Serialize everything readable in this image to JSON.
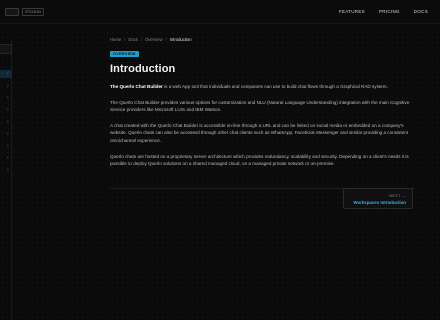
{
  "header": {
    "badge": "STUDIO",
    "nav": [
      "FEATURES",
      "PRICING",
      "DOCS"
    ]
  },
  "sidebar": {
    "chevrons": [
      "›",
      "›",
      "›",
      "›",
      "›",
      "›",
      "›",
      "›",
      "›"
    ]
  },
  "breadcrumb": [
    "Home",
    "Docs",
    "Overview",
    "Introduction"
  ],
  "breadcrumb_separator": "/",
  "badge": "OVERVIEW",
  "title": "Introduction",
  "paragraphs": [
    {
      "strong": "The Querlo Chat Builder",
      "text": " is a web App tool that individuals and companies can use to build chat flows through a Graphical RAD system."
    },
    {
      "text": "The Querlo Chat Builder provides various options for customization and NLU (Natural Language Understanding) integration with the main Cognitive Service providers like Microsoft LUIS and IBM Watson."
    },
    {
      "text": "A chat created with the Querlo Chat Builder is accessible on-line through a URL and can be linked on social media or embedded on a company's website. Querlo chats can also be accessed through other chat clients such as WhatsApp, Facebook Messenger and similar providing a consistent omnichannel experience."
    },
    {
      "text": "Querlo chats are hosted on a proprietary server architecture which provides redundancy, scalability and security. Depending on a client's needs it is possible to deploy Querlo solutions on a shared managed cloud, on a managed private network or on-premise."
    }
  ],
  "next": {
    "label": "NEXT →",
    "title": "Workspaces Introduction"
  },
  "colors": {
    "accent": "#1f9fd0",
    "link": "#35b6e6",
    "background": "#0b0b0b"
  }
}
